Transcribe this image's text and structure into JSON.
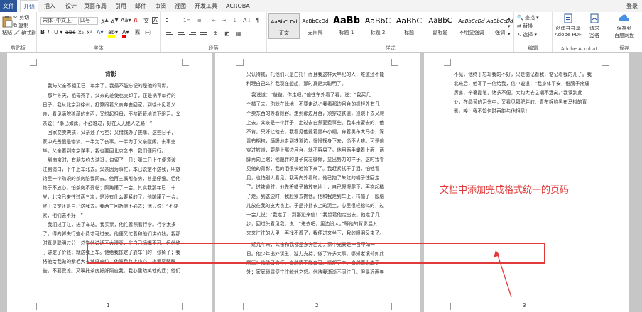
{
  "tabs": {
    "file": "文件",
    "items": [
      "开始",
      "插入",
      "设计",
      "页面布局",
      "引用",
      "邮件",
      "审阅",
      "视图",
      "开发工具",
      "ACROBAT"
    ],
    "login": "登录"
  },
  "clipboard": {
    "paste": "粘贴",
    "cut": "剪切",
    "copy": "复制",
    "painter": "格式刷",
    "label": "剪贴板"
  },
  "font": {
    "name": "宋体 (中文正)",
    "size": "四号",
    "label": "字体"
  },
  "paragraph": {
    "label": "段落"
  },
  "styles": {
    "label": "样式",
    "items": [
      {
        "preview": "AaBbCcDd",
        "name": "正文"
      },
      {
        "preview": "AaBbCcDd",
        "name": "无间隔"
      },
      {
        "preview": "AaBb",
        "name": "标题 1"
      },
      {
        "preview": "AaBbC",
        "name": "标题 2"
      },
      {
        "preview": "AaBbC",
        "name": "标题"
      },
      {
        "preview": "AaBbC",
        "name": "副标题"
      },
      {
        "preview": "AaBbCcDd",
        "name": "不明显强调"
      },
      {
        "preview": "AaBbCcDd",
        "name": "强调"
      }
    ]
  },
  "editing": {
    "find": "查找",
    "replace": "替换",
    "select": "选择",
    "label": "编辑"
  },
  "acrobat": {
    "create": "创建并共享",
    "create2": "Adobe PDF",
    "request": "请求",
    "request2": "签名",
    "label": "Adobe Acrobat"
  },
  "save": {
    "label1": "保存到",
    "label2": "百度网盘",
    "label": "保存"
  },
  "page1": {
    "title": "背影",
    "lines": [
      "我与父亲不相见已二年余了，我最不能忘记的是他的背影。",
      "那年冬天，祖母死了，父亲的差使也交卸了，正是祸不单行的",
      "日子，我从北京到徐州，打算跟着父亲奔丧回家。到徐州见着父",
      "亲，看见满院狼藉的东西，又想起祖母，不禁簌簌地流下眼泪。父",
      "亲说：“事已如此，不必难过，好在天无绝人之路！”",
      "回家变卖典质，父亲还了亏空；又借钱办了丧事。这些日子，",
      "家中光景很是惨淡，一半为了丧事，一半为了父亲赋闲。丧事完",
      "毕，父亲要到南京谋事，我也要回北京念书，我们便同行。",
      "到南京时，有朋友约去游逛，勾留了一日；第二日上午便须渡",
      "江到浦口，下午上车北去。父亲因为事忙，本已说定不送我，叫旅",
      "馆里一个熟识的茶房陪我同去。他再三嘱咐茶房，甚是仔细。但他",
      "终于不放心，怕茶房不妥帖；颇踌躇了一会。其实我那年已二十",
      "岁，北京已来往过两三次，是没有什么要紧的了。他踌躇了一会，",
      "终于决定还是自己送我去。我两三回劝他不必去；他只说：“不要",
      "紧，他们去不好！”",
      "我们过了江，进了车站。我买票，他忙着照看行李。行李太多",
      "了，得向脚夫行些小费才可过去。他便又忙着和他们讲价钱。我那",
      "时真是聪明过分，总觉他说话不大漂亮，非自己插嘴不可。但他终",
      "于讲定了价钱；就送我上车。他给我拣定了靠车门的一张椅子；我",
      "将他给我做的紫毛大衣铺好座位。他嘱我路上小心，夜里要警醒",
      "些，不要受凉。又嘱托茶房好好照应我。我心里暗笑他的迂；他们"
    ],
    "num": "1"
  },
  "page2": {
    "lines": [
      "只认得钱，托他们只是白托！而且我这样大年纪的人，难道还不能",
      "料理自己么？我现在想想，那时真是太聪明了。",
      "我说道：“爸爸，你走吧。”他往车外看了看，说：“我买几",
      "个橘子去。你就在此地，不要走动。”我看那边月台的栅栏外有几",
      "个卖东西的等着顾客。走到那边月台，须穿过铁道，须跳下去又爬",
      "上去。父亲是一个胖子，走过去自然要费事些。我本来要去的，他",
      "不肯，只好让他去。我看见他戴着黑布小帽，穿着黑布大马褂，深",
      "青布棉袍，蹒跚地走到铁道边，慢慢探身下去，尚不大难。可是他",
      "穿过铁道，要爬上那边月台，就不容易了。他用两手攀着上面，两",
      "脚再向上缩；他肥胖的身子向左微倾，显出努力的样子。这时我看",
      "见他的背影，我的泪很快地流下来了。我赶紧拭干了泪，怕他看",
      "见，也怕别人看见。我再向外看时，他已抱了朱红的橘子往回走",
      "了。过铁道时，他先将橘子散放在地上，自己慢慢爬下，再抱起橘",
      "子走。到这边时，我赶紧去搀他。他和我走到车上，将橘子一股脑",
      "儿放在我的皮大衣上。于是扑扑衣上的泥土，心里很轻松似的，过",
      "一会儿说：“我走了，到那边来信！”我望着他走出去。他走了几",
      "步，回过头看见我，说：“进去吧，里边没人。”等他的背影混入",
      "来来往往的人里，再找不着了，我便进来坐下，我的眼泪又来了。",
      "近几年来，父亲和我都是东奔西走，家中光景是一日不如一",
      "日。他少年出外谋生，独力支持，做了许多大事。哪知老境却如此",
      "颓唐！他触目伤怀，自然情不能自已。情郁于中，自然要发之于",
      "外；家庭琐屑便往往触他之怒。他待我渐渐不同往日。但最近两年"
    ],
    "num": "2"
  },
  "page3": {
    "lines": [
      "不见，他终于忘却我的不好，只是惦记着我，惦记着我的儿子。我",
      "北来后，他写了一信给我，信中说道：“我身体平安，惟膀子疼痛",
      "厉害，举箸提笔，诸多不便，大约大去之期不远矣。”我读到此",
      "处，在晶莹的泪光中，又看见那肥胖的、青布棉袍黑布马褂的背",
      "影。唉！我不知何时再能与他相见！"
    ],
    "num": "3"
  },
  "annotation": "文档中添加完成格式统一的页码"
}
